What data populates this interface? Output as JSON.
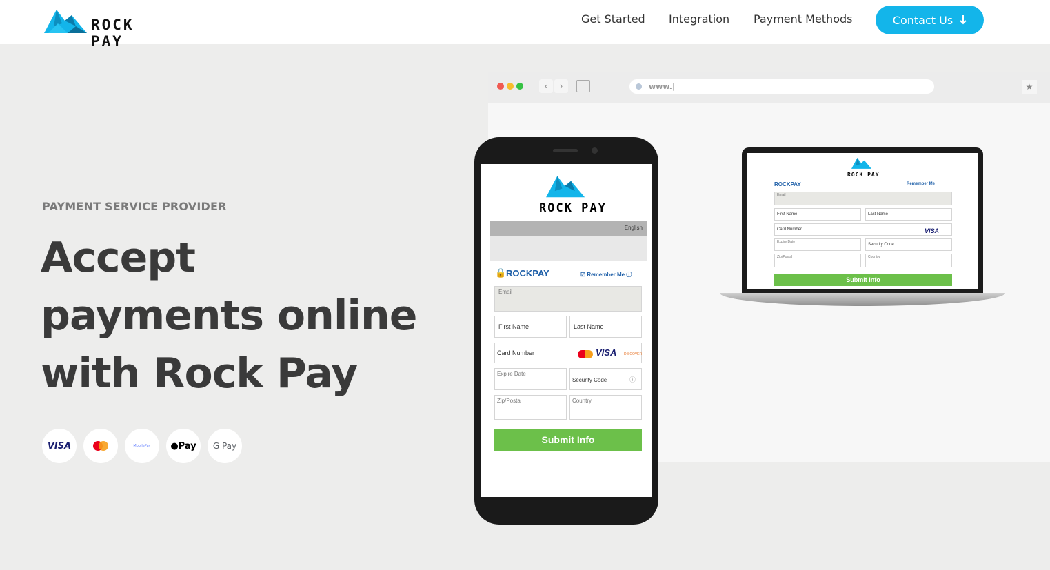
{
  "brand": {
    "name": "ROCK PAY",
    "accent": "#13b5ea"
  },
  "nav": {
    "items": [
      "Get Started",
      "Integration",
      "Payment Methods"
    ],
    "contact_label": "Contact Us",
    "contact_icon": "arrow-down-icon"
  },
  "hero": {
    "eyebrow": "PAYMENT SERVICE PROVIDER",
    "headline_1": "Accept",
    "headline_2": "payments online",
    "headline_3": "with Rock Pay"
  },
  "payment_methods": [
    "VISA",
    "Mastercard",
    "MobilePay",
    "Pay",
    "G Pay"
  ],
  "browser": {
    "url": "www.|"
  },
  "form": {
    "brand": "ROCKPAY",
    "language": "English",
    "remember": "Remember Me",
    "email": "Email",
    "first_name": "First Name",
    "last_name": "Last Name",
    "card_number": "Card Number",
    "expire_date": "Expire Date",
    "security_code": "Security Code",
    "zip": "Zip/Postal",
    "country": "Country",
    "submit": "Submit Info",
    "visa": "VISA",
    "discover": "DISCOVER"
  }
}
